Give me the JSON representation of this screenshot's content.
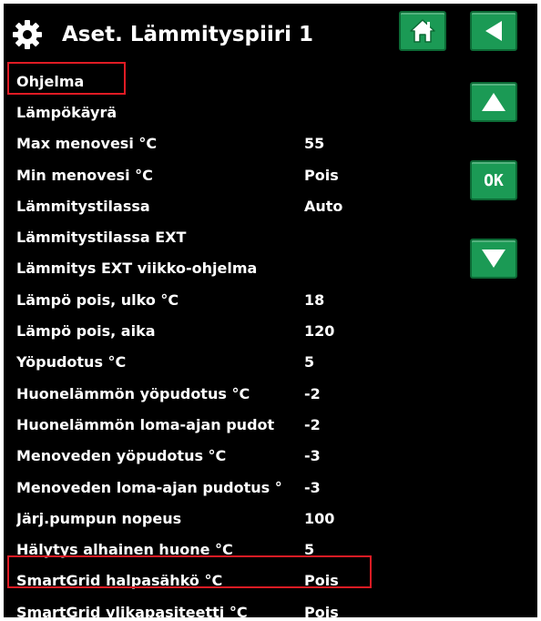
{
  "header": {
    "title": "Aset. Lämmityspiiri 1",
    "gear_icon": "gear-icon",
    "home_icon": "home-icon",
    "back_icon": "back-arrow-icon"
  },
  "nav": {
    "up_icon": "arrow-up-icon",
    "ok_label": "OK",
    "down_icon": "arrow-down-icon"
  },
  "colors": {
    "background": "#000000",
    "button": "#1b9a55",
    "selection": "#e01b24",
    "text": "#ffffff"
  },
  "menu": {
    "items": [
      {
        "label": "Ohjelma",
        "value": ""
      },
      {
        "label": "Lämpökäyrä",
        "value": ""
      },
      {
        "label": "Max menovesi °C",
        "value": "55"
      },
      {
        "label": "Min menovesi °C",
        "value": "Pois"
      },
      {
        "label": "Lämmitystilassa",
        "value": "Auto"
      },
      {
        "label": "Lämmitystilassa EXT",
        "value": ""
      },
      {
        "label": "Lämmitys EXT viikko-ohjelma",
        "value": ""
      },
      {
        "label": "Lämpö pois, ulko °C",
        "value": "18"
      },
      {
        "label": "Lämpö pois, aika",
        "value": "120"
      },
      {
        "label": "Yöpudotus °C",
        "value": "5"
      },
      {
        "label": "Huonelämmön yöpudotus °C",
        "value": "-2"
      },
      {
        "label": "Huonelämmön loma-ajan pudot",
        "value": "-2"
      },
      {
        "label": "Menoveden yöpudotus °C",
        "value": "-3"
      },
      {
        "label": "Menoveden loma-ajan pudotus °",
        "value": "-3"
      },
      {
        "label": "Järj.pumpun nopeus",
        "value": "100"
      },
      {
        "label": "Hälytys alhainen huone °C",
        "value": "5"
      },
      {
        "label": "SmartGrid halpasähkö °C",
        "value": "Pois"
      },
      {
        "label": "SmartGrid ylikapasiteetti °C",
        "value": "Pois"
      }
    ]
  }
}
